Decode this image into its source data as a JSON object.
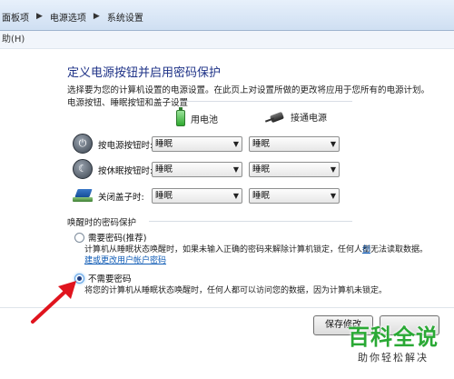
{
  "breadcrumb": {
    "items": [
      "面板项",
      "电源选项",
      "系统设置"
    ]
  },
  "menubar": {
    "help": "助(H)"
  },
  "page": {
    "title": "定义电源按钮并启用密码保护",
    "description": "选择要为您的计算机设置的电源设置。在此页上对设置所做的更改将应用于您所有的电源计划。"
  },
  "power_section": {
    "heading": "电源按钮、睡眠按钮和盖子设置",
    "col_battery": "用电池",
    "col_plugged": "接通电源",
    "rows": [
      {
        "label": "按电源按钮时:",
        "icon": "power-icon",
        "battery": "睡眠",
        "plugged": "睡眠"
      },
      {
        "label": "按休眠按钮时:",
        "icon": "sleep-icon",
        "battery": "睡眠",
        "plugged": "睡眠"
      },
      {
        "label": "关闭盖子时:",
        "icon": "laptop-lid-icon",
        "battery": "睡眠",
        "plugged": "睡眠"
      }
    ]
  },
  "password_section": {
    "heading": "唤醒时的密码保护",
    "opt1_label": "需要密码(推荐)",
    "opt1_desc": "计算机从睡眠状态唤醒时，如果未输入正确的密码来解除计算机锁定，任何人都无法读取数据。",
    "opt1_link_a": "创",
    "opt1_link_b": "建或更改用户帐户密码",
    "opt2_label": "不需要密码",
    "opt2_desc": "将您的计算机从睡眠状态唤醒时，任何人都可以访问您的数据，因为计算机未锁定。",
    "selected": "不需要密码"
  },
  "buttons": {
    "save": "保存修改",
    "cancel": ""
  },
  "watermark": {
    "main": "百科全说",
    "sub": "助你轻松解决"
  },
  "colors": {
    "accent": "#1e3287",
    "link": "#0f5bb5",
    "arrow": "#e0141e",
    "watermark": "#2aa935"
  }
}
